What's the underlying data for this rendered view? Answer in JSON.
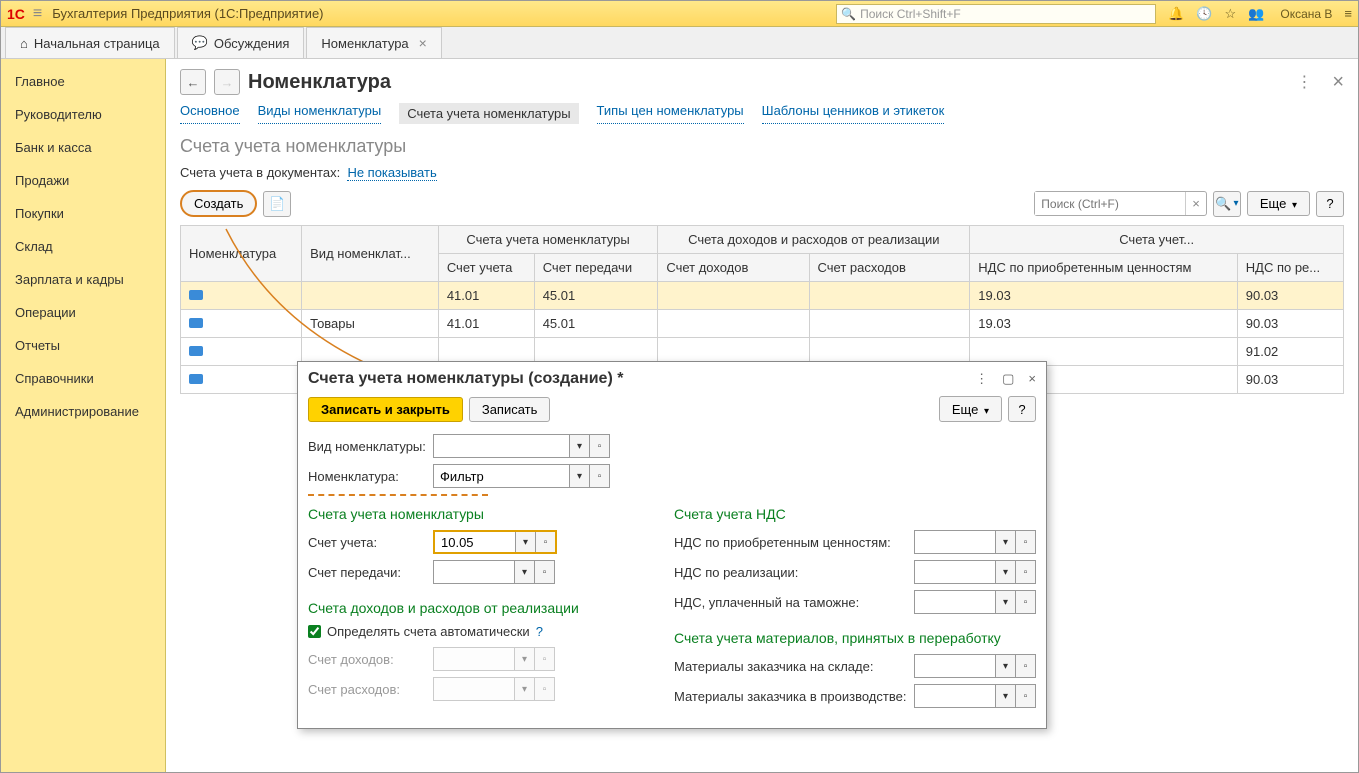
{
  "titlebar": {
    "app_title": "Бухгалтерия Предприятия  (1С:Предприятие)",
    "search_placeholder": "Поиск Ctrl+Shift+F",
    "user_name": "Оксана В"
  },
  "maintabs": {
    "home": "Начальная страница",
    "discussions": "Обсуждения",
    "nomenclature": "Номенклатура"
  },
  "sidebar": {
    "items": [
      "Главное",
      "Руководителю",
      "Банк и касса",
      "Продажи",
      "Покупки",
      "Склад",
      "Зарплата и кадры",
      "Операции",
      "Отчеты",
      "Справочники",
      "Администрирование"
    ]
  },
  "page": {
    "title": "Номенклатура",
    "subnav": {
      "main": "Основное",
      "types": "Виды номенклатуры",
      "accounts": "Счета учета номенклатуры",
      "price_types": "Типы цен номенклатуры",
      "templates": "Шаблоны ценников и этикеток"
    },
    "section_title": "Счета учета номенклатуры",
    "filter_label": "Счета учета в документах:",
    "filter_value": "Не показывать",
    "btn_create": "Создать",
    "search_placeholder": "Поиск (Ctrl+F)",
    "btn_more": "Еще",
    "btn_help": "?",
    "columns": {
      "nomenclature": "Номенклатура",
      "nom_type": "Вид номенклат...",
      "group_accounts": "Счета учета номенклатуры",
      "group_income": "Счета доходов и расходов от реализации",
      "group_vat": "Счета учет...",
      "account": "Счет учета",
      "transfer": "Счет передачи",
      "income": "Счет доходов",
      "expense": "Счет расходов",
      "vat_purchase": "НДС по приобретенным ценностям",
      "vat_sale": "НДС по ре..."
    },
    "rows": [
      {
        "nomenclature": "",
        "nom_type": "",
        "account": "41.01",
        "transfer": "45.01",
        "income": "",
        "expense": "",
        "vat_purchase": "19.03",
        "vat_sale": "90.03",
        "selected": true
      },
      {
        "nomenclature": "",
        "nom_type": "Товары",
        "account": "41.01",
        "transfer": "45.01",
        "income": "",
        "expense": "",
        "vat_purchase": "19.03",
        "vat_sale": "90.03"
      },
      {
        "nomenclature": "",
        "nom_type": "",
        "account": "",
        "transfer": "",
        "income": "",
        "expense": "",
        "vat_purchase": "",
        "vat_sale": "91.02"
      },
      {
        "nomenclature": "",
        "nom_type": "",
        "account": "",
        "transfer": "",
        "income": "",
        "expense": "",
        "vat_purchase": "",
        "vat_sale": "90.03"
      }
    ]
  },
  "dialog": {
    "title": "Счета учета номенклатуры (создание) *",
    "btn_save_close": "Записать и закрыть",
    "btn_save": "Записать",
    "btn_more": "Еще",
    "btn_help": "?",
    "fields": {
      "nom_type_label": "Вид номенклатуры:",
      "nomenclature_label": "Номенклатура:",
      "nomenclature_value": "Фильтр",
      "group_accounts": "Счета учета номенклатуры",
      "account_label": "Счет учета:",
      "account_value": "10.05",
      "transfer_label": "Счет передачи:",
      "group_vat": "Счета учета НДС",
      "vat_purchase_label": "НДС по приобретенным ценностям:",
      "vat_sale_label": "НДС по реализации:",
      "vat_customs_label": "НДС, уплаченный на таможне:",
      "group_income": "Счета доходов и расходов от реализации",
      "auto_checkbox": "Определять счета автоматически",
      "income_label": "Счет доходов:",
      "expense_label": "Счет расходов:",
      "group_materials": "Счета учета материалов, принятых в переработку",
      "materials_stock_label": "Материалы заказчика на складе:",
      "materials_prod_label": "Материалы заказчика в производстве:"
    }
  }
}
